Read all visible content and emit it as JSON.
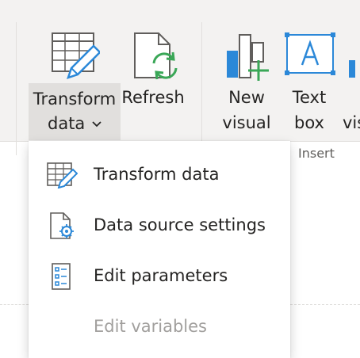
{
  "ribbon": {
    "transform": {
      "line1": "Transform",
      "line2": "data"
    },
    "refresh": {
      "label": "Refresh"
    },
    "new_visual": {
      "line1": "New",
      "line2": "visual"
    },
    "text_box": {
      "line1": "Text",
      "line2": "box"
    },
    "more_visuals": {
      "line2": "vis"
    },
    "insert_group_label": "Insert"
  },
  "menu": {
    "items": [
      {
        "label": "Transform data",
        "enabled": true,
        "icon": "transform-data-icon"
      },
      {
        "label": "Data source settings",
        "enabled": true,
        "icon": "data-source-settings-icon"
      },
      {
        "label": "Edit parameters",
        "enabled": true,
        "icon": "edit-parameters-icon"
      },
      {
        "label": "Edit variables",
        "enabled": false,
        "icon": ""
      }
    ]
  },
  "colors": {
    "accent": "#2b88d8",
    "refresh_green": "#3aa757",
    "ribbon_bg": "#f3f2f1"
  }
}
